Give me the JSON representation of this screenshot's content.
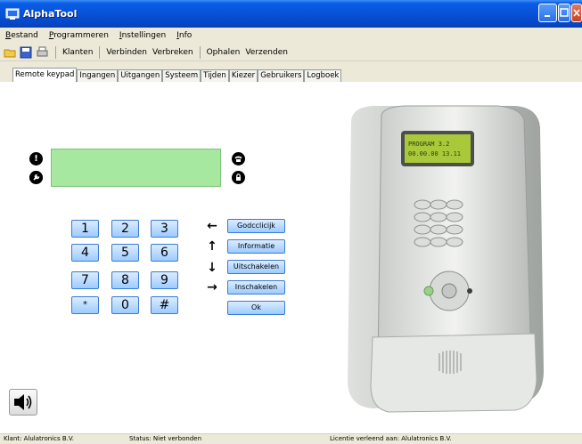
{
  "window": {
    "title": "AlphaTool"
  },
  "menu": [
    {
      "label": "Bestand",
      "ul": "B"
    },
    {
      "label": "Programmeren",
      "ul": "P"
    },
    {
      "label": "Instellingen",
      "ul": "I"
    },
    {
      "label": "Info",
      "ul": "I"
    }
  ],
  "toolbar": {
    "klanten": "Klanten",
    "verbinden": "Verbinden",
    "verbreken": "Verbreken",
    "ophalen": "Ophalen",
    "verzenden": "Verzenden"
  },
  "tabs": [
    "Remote keypad",
    "Ingangen",
    "Uitgangen",
    "Systeem",
    "Tijden",
    "Kiezer",
    "Gebruikers",
    "Logboek"
  ],
  "keypad": {
    "keys": [
      "1",
      "2",
      "3",
      "4",
      "5",
      "6",
      "7",
      "8",
      "9",
      "*",
      "0",
      "#"
    ]
  },
  "functions": {
    "godcclicijk": "Godcclicijk",
    "informatie": "Informatie",
    "uitschakelen": "Uitschakelen",
    "inschakelen": "Inschakelen",
    "ok": "Ok"
  },
  "arrows": {
    "left": "←",
    "up": "↑",
    "down": "↓",
    "right": "→"
  },
  "indicators": {
    "info": "!",
    "repair": "✎",
    "phone": "☎",
    "lock": "🔒"
  },
  "device": {
    "lcd_line1": "PROGRAM 3.2",
    "lcd_line2": "00.00.00 13.11"
  },
  "status": {
    "klant": "Klant:  Alulatronics B.V.",
    "status": "Status:  Niet verbonden",
    "licentie": "Licentie verleend aan:  Alulatronics B.V."
  },
  "colors": {
    "titlebar": "#0851d8",
    "lcd": "#a6e8a0",
    "key_top": "#dcecff",
    "key_bottom": "#9ccbff"
  }
}
